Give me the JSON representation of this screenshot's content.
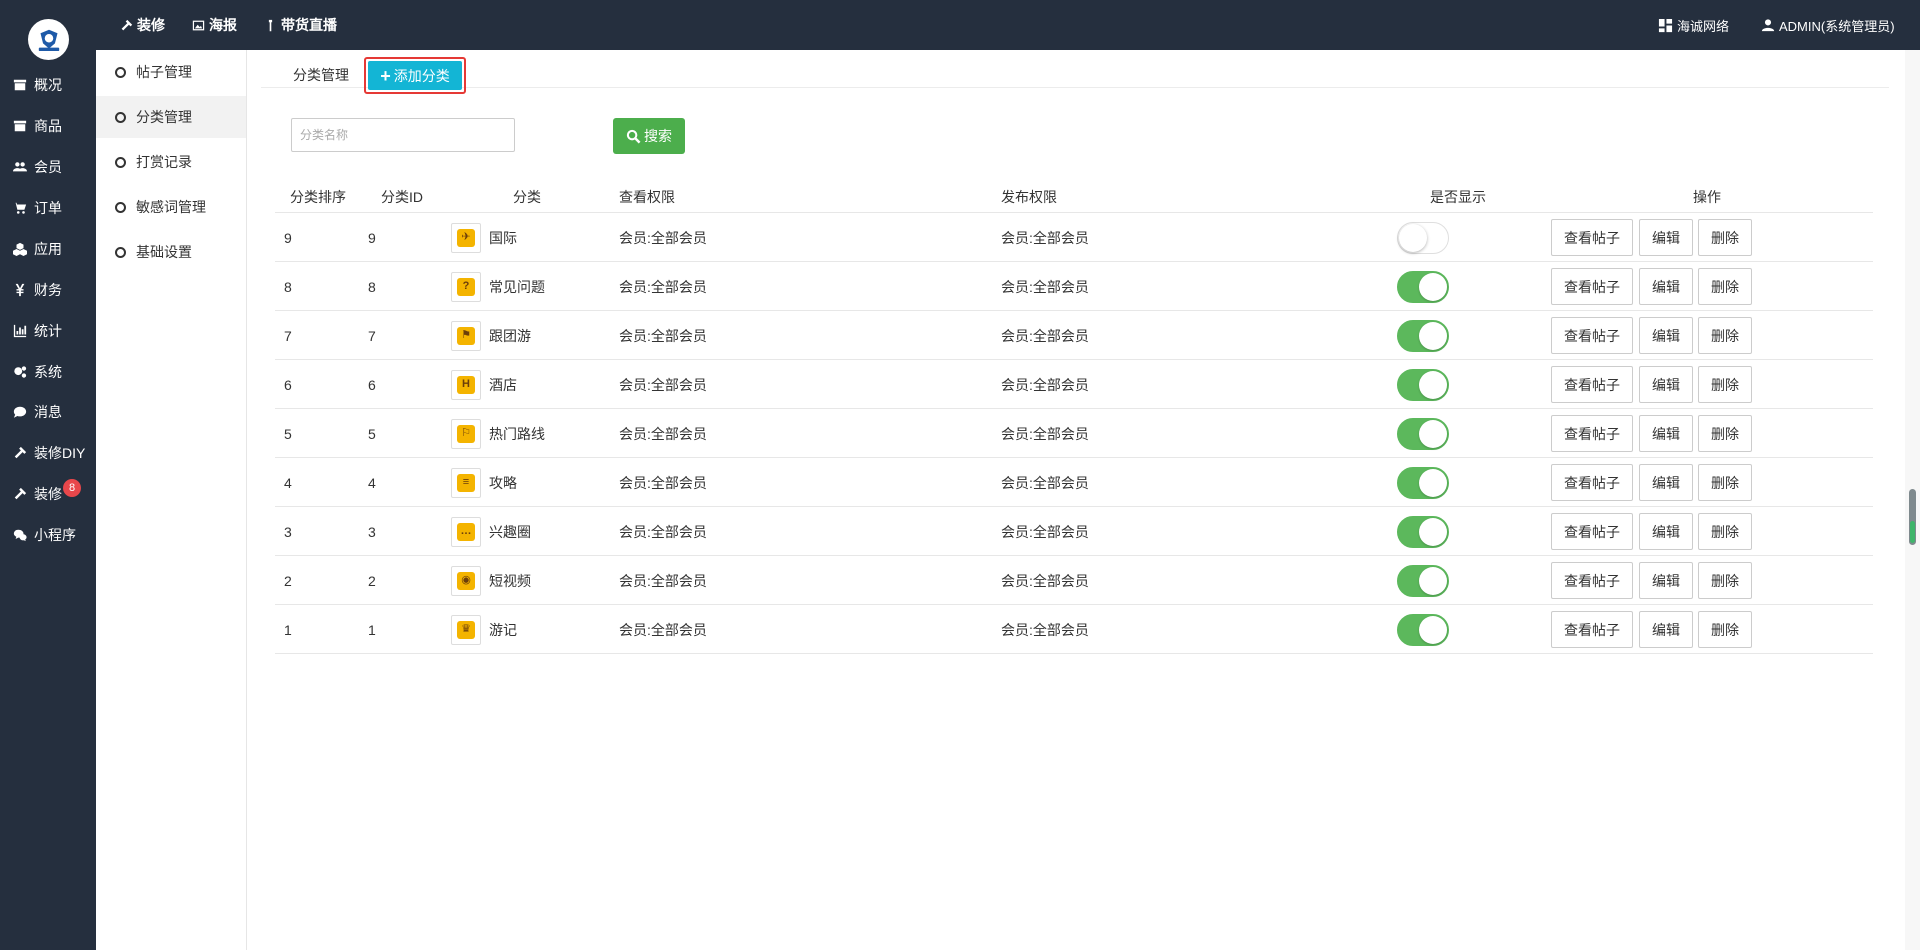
{
  "left_nav": {
    "logo_alt": "logo-icon",
    "items": [
      {
        "label": "概况",
        "icon": "archive-icon"
      },
      {
        "label": "商品",
        "icon": "box-icon"
      },
      {
        "label": "会员",
        "icon": "users-icon"
      },
      {
        "label": "订单",
        "icon": "cart-icon"
      },
      {
        "label": "应用",
        "icon": "cubes-icon"
      },
      {
        "label": "财务",
        "icon": "yen-icon"
      },
      {
        "label": "统计",
        "icon": "bar-chart-icon"
      },
      {
        "label": "系统",
        "icon": "gears-icon"
      },
      {
        "label": "消息",
        "icon": "comment-icon"
      },
      {
        "label": "装修DIY",
        "icon": "gavel-icon"
      },
      {
        "label": "装修",
        "icon": "gavel-icon"
      },
      {
        "label": "小程序",
        "icon": "wechat-icon"
      }
    ],
    "message_badge": "8"
  },
  "topbar": {
    "links": [
      {
        "label": "装修",
        "icon": "gavel-icon"
      },
      {
        "label": "海报",
        "icon": "image-icon"
      },
      {
        "label": "带货直播",
        "icon": "microphone-icon"
      }
    ],
    "company": "海诚网络",
    "user": "ADMIN(系统管理员)"
  },
  "sub_nav": {
    "items": [
      "帖子管理",
      "分类管理",
      "打赏记录",
      "敏感词管理",
      "基础设置"
    ],
    "active_index": 1
  },
  "tabs": {
    "current": "分类管理",
    "add_button": "添加分类"
  },
  "search": {
    "placeholder": "分类名称",
    "value": "",
    "button": "搜索"
  },
  "table": {
    "headers": {
      "sort": "分类排序",
      "id": "分类ID",
      "category": "分类",
      "view_perm": "查看权限",
      "post_perm": "发布权限",
      "show": "是否显示",
      "actions": "操作"
    },
    "action_labels": {
      "view_posts": "查看帖子",
      "edit": "编辑",
      "delete": "删除"
    },
    "rows": [
      {
        "sort": "9",
        "id": "9",
        "name": "国际",
        "icon": "airplane-icon",
        "glyph": "✈",
        "view": "会员:全部会员",
        "post": "会员:全部会员",
        "show": false
      },
      {
        "sort": "8",
        "id": "8",
        "name": "常见问题",
        "icon": "notebook-icon",
        "glyph": "?",
        "view": "会员:全部会员",
        "post": "会员:全部会员",
        "show": true
      },
      {
        "sort": "7",
        "id": "7",
        "name": "跟团游",
        "icon": "flag-icon",
        "glyph": "⚑",
        "view": "会员:全部会员",
        "post": "会员:全部会员",
        "show": true
      },
      {
        "sort": "6",
        "id": "6",
        "name": "酒店",
        "icon": "hotel-icon",
        "glyph": "H",
        "view": "会员:全部会员",
        "post": "会员:全部会员",
        "show": true
      },
      {
        "sort": "5",
        "id": "5",
        "name": "热门路线",
        "icon": "signpost-icon",
        "glyph": "⚐",
        "view": "会员:全部会员",
        "post": "会员:全部会员",
        "show": true
      },
      {
        "sort": "4",
        "id": "4",
        "name": "攻略",
        "icon": "book-icon",
        "glyph": "≡",
        "view": "会员:全部会员",
        "post": "会员:全部会员",
        "show": true
      },
      {
        "sort": "3",
        "id": "3",
        "name": "兴趣圈",
        "icon": "chat-bubble-icon",
        "glyph": "…",
        "view": "会员:全部会员",
        "post": "会员:全部会员",
        "show": true
      },
      {
        "sort": "2",
        "id": "2",
        "name": "短视频",
        "icon": "camera-icon",
        "glyph": "◉",
        "view": "会员:全部会员",
        "post": "会员:全部会员",
        "show": true
      },
      {
        "sort": "1",
        "id": "1",
        "name": "游记",
        "icon": "medal-icon",
        "glyph": "♛",
        "view": "会员:全部会员",
        "post": "会员:全部会员",
        "show": true
      }
    ]
  },
  "colors": {
    "sidebar_bg": "#252f3e",
    "add_button": "#13b5d5",
    "search_button": "#4cae4c",
    "toggle_on": "#5cb85c",
    "badge": "#e8474b",
    "icon_fill": "#f4b400"
  }
}
